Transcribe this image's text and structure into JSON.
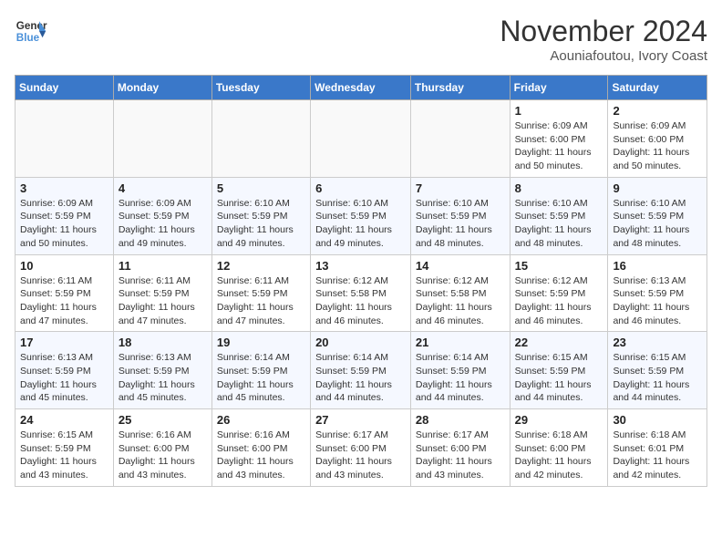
{
  "header": {
    "logo_line1": "General",
    "logo_line2": "Blue",
    "month": "November 2024",
    "location": "Aouniafoutou, Ivory Coast"
  },
  "weekdays": [
    "Sunday",
    "Monday",
    "Tuesday",
    "Wednesday",
    "Thursday",
    "Friday",
    "Saturday"
  ],
  "weeks": [
    [
      {
        "day": "",
        "info": ""
      },
      {
        "day": "",
        "info": ""
      },
      {
        "day": "",
        "info": ""
      },
      {
        "day": "",
        "info": ""
      },
      {
        "day": "",
        "info": ""
      },
      {
        "day": "1",
        "info": "Sunrise: 6:09 AM\nSunset: 6:00 PM\nDaylight: 11 hours\nand 50 minutes."
      },
      {
        "day": "2",
        "info": "Sunrise: 6:09 AM\nSunset: 6:00 PM\nDaylight: 11 hours\nand 50 minutes."
      }
    ],
    [
      {
        "day": "3",
        "info": "Sunrise: 6:09 AM\nSunset: 5:59 PM\nDaylight: 11 hours\nand 50 minutes."
      },
      {
        "day": "4",
        "info": "Sunrise: 6:09 AM\nSunset: 5:59 PM\nDaylight: 11 hours\nand 49 minutes."
      },
      {
        "day": "5",
        "info": "Sunrise: 6:10 AM\nSunset: 5:59 PM\nDaylight: 11 hours\nand 49 minutes."
      },
      {
        "day": "6",
        "info": "Sunrise: 6:10 AM\nSunset: 5:59 PM\nDaylight: 11 hours\nand 49 minutes."
      },
      {
        "day": "7",
        "info": "Sunrise: 6:10 AM\nSunset: 5:59 PM\nDaylight: 11 hours\nand 48 minutes."
      },
      {
        "day": "8",
        "info": "Sunrise: 6:10 AM\nSunset: 5:59 PM\nDaylight: 11 hours\nand 48 minutes."
      },
      {
        "day": "9",
        "info": "Sunrise: 6:10 AM\nSunset: 5:59 PM\nDaylight: 11 hours\nand 48 minutes."
      }
    ],
    [
      {
        "day": "10",
        "info": "Sunrise: 6:11 AM\nSunset: 5:59 PM\nDaylight: 11 hours\nand 47 minutes."
      },
      {
        "day": "11",
        "info": "Sunrise: 6:11 AM\nSunset: 5:59 PM\nDaylight: 11 hours\nand 47 minutes."
      },
      {
        "day": "12",
        "info": "Sunrise: 6:11 AM\nSunset: 5:59 PM\nDaylight: 11 hours\nand 47 minutes."
      },
      {
        "day": "13",
        "info": "Sunrise: 6:12 AM\nSunset: 5:58 PM\nDaylight: 11 hours\nand 46 minutes."
      },
      {
        "day": "14",
        "info": "Sunrise: 6:12 AM\nSunset: 5:58 PM\nDaylight: 11 hours\nand 46 minutes."
      },
      {
        "day": "15",
        "info": "Sunrise: 6:12 AM\nSunset: 5:59 PM\nDaylight: 11 hours\nand 46 minutes."
      },
      {
        "day": "16",
        "info": "Sunrise: 6:13 AM\nSunset: 5:59 PM\nDaylight: 11 hours\nand 46 minutes."
      }
    ],
    [
      {
        "day": "17",
        "info": "Sunrise: 6:13 AM\nSunset: 5:59 PM\nDaylight: 11 hours\nand 45 minutes."
      },
      {
        "day": "18",
        "info": "Sunrise: 6:13 AM\nSunset: 5:59 PM\nDaylight: 11 hours\nand 45 minutes."
      },
      {
        "day": "19",
        "info": "Sunrise: 6:14 AM\nSunset: 5:59 PM\nDaylight: 11 hours\nand 45 minutes."
      },
      {
        "day": "20",
        "info": "Sunrise: 6:14 AM\nSunset: 5:59 PM\nDaylight: 11 hours\nand 44 minutes."
      },
      {
        "day": "21",
        "info": "Sunrise: 6:14 AM\nSunset: 5:59 PM\nDaylight: 11 hours\nand 44 minutes."
      },
      {
        "day": "22",
        "info": "Sunrise: 6:15 AM\nSunset: 5:59 PM\nDaylight: 11 hours\nand 44 minutes."
      },
      {
        "day": "23",
        "info": "Sunrise: 6:15 AM\nSunset: 5:59 PM\nDaylight: 11 hours\nand 44 minutes."
      }
    ],
    [
      {
        "day": "24",
        "info": "Sunrise: 6:15 AM\nSunset: 5:59 PM\nDaylight: 11 hours\nand 43 minutes."
      },
      {
        "day": "25",
        "info": "Sunrise: 6:16 AM\nSunset: 6:00 PM\nDaylight: 11 hours\nand 43 minutes."
      },
      {
        "day": "26",
        "info": "Sunrise: 6:16 AM\nSunset: 6:00 PM\nDaylight: 11 hours\nand 43 minutes."
      },
      {
        "day": "27",
        "info": "Sunrise: 6:17 AM\nSunset: 6:00 PM\nDaylight: 11 hours\nand 43 minutes."
      },
      {
        "day": "28",
        "info": "Sunrise: 6:17 AM\nSunset: 6:00 PM\nDaylight: 11 hours\nand 43 minutes."
      },
      {
        "day": "29",
        "info": "Sunrise: 6:18 AM\nSunset: 6:00 PM\nDaylight: 11 hours\nand 42 minutes."
      },
      {
        "day": "30",
        "info": "Sunrise: 6:18 AM\nSunset: 6:01 PM\nDaylight: 11 hours\nand 42 minutes."
      }
    ]
  ]
}
